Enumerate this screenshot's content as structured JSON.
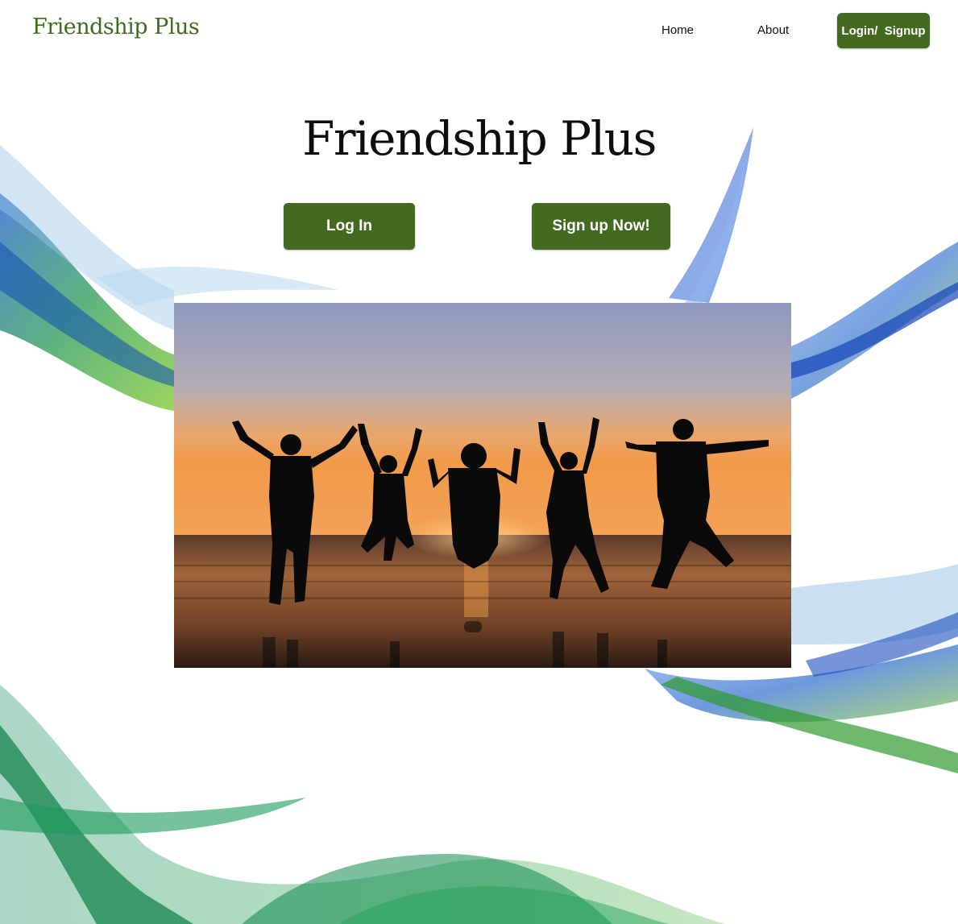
{
  "header": {
    "brand": "Friendship Plus",
    "nav": {
      "home": "Home",
      "about": "About",
      "login_signup": "Login/  Signup"
    }
  },
  "hero": {
    "title": "Friendship Plus",
    "login_button": "Log In",
    "signup_button": "Sign up Now!"
  },
  "theme": {
    "accent": "#446a22",
    "brand_text": "#3f6b1e"
  }
}
